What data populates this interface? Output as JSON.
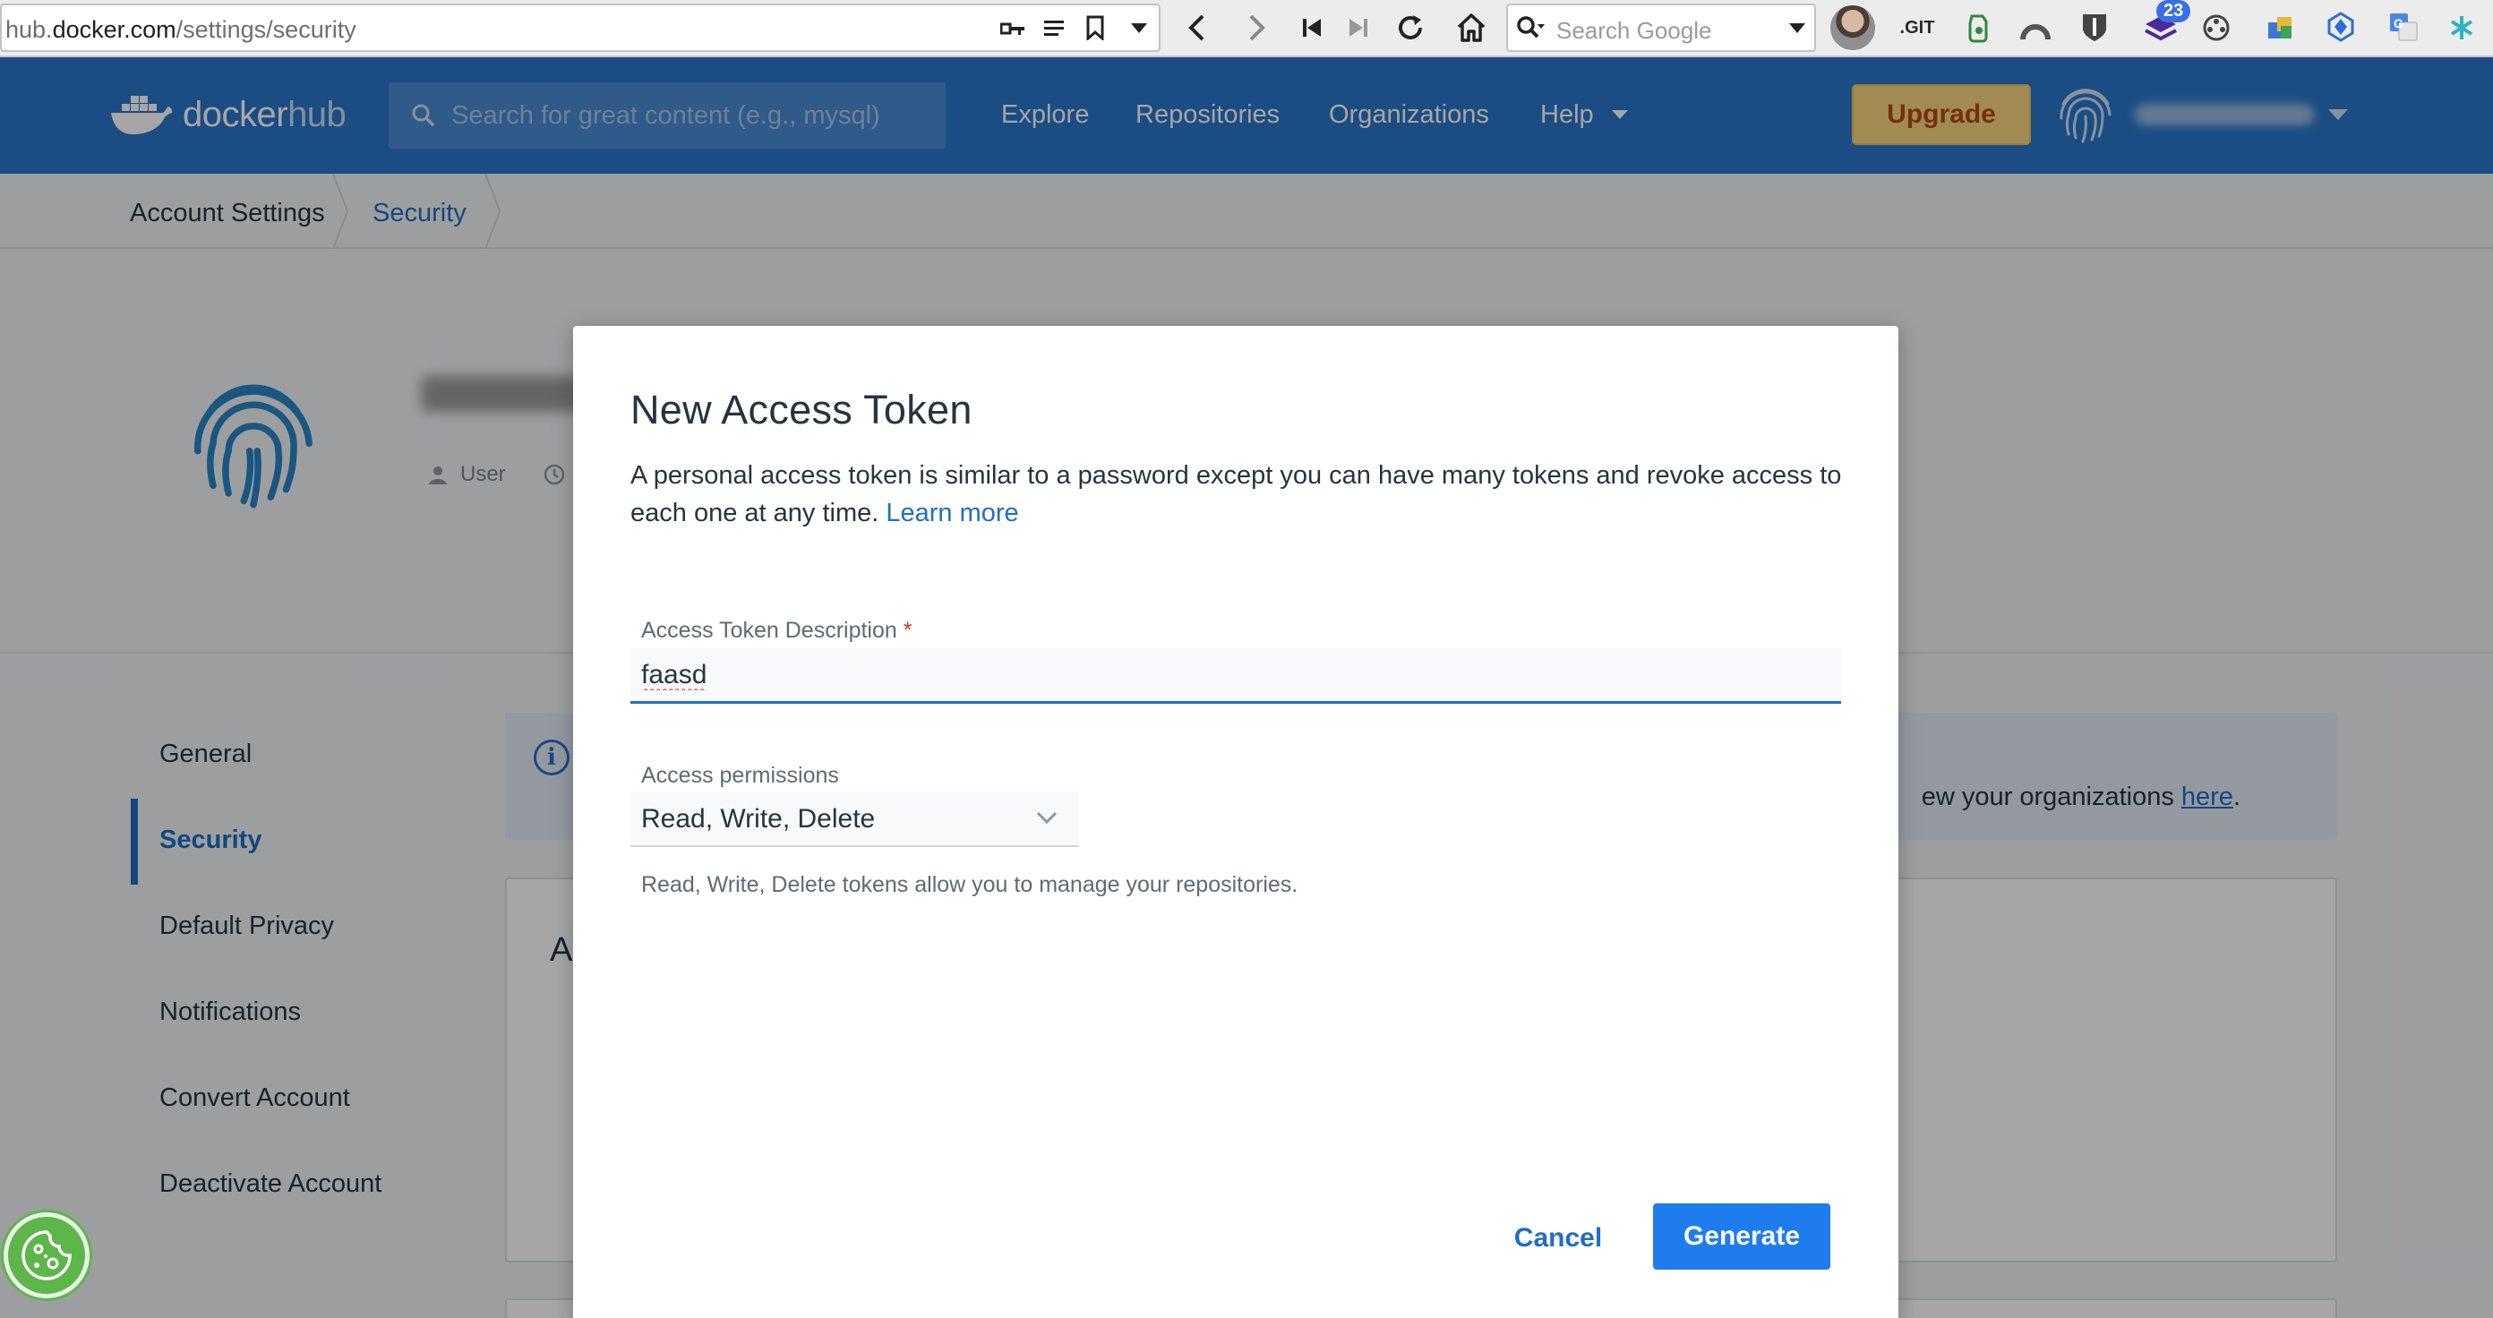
{
  "browser": {
    "url_prefix": "hub.",
    "url_domain": "docker.com",
    "url_path": "/settings/security",
    "search_placeholder": "Search Google",
    "git_label": ".GIT",
    "extension_badge": "23"
  },
  "header": {
    "logo_docker": "docker",
    "logo_hub": "hub",
    "search_placeholder": "Search for great content (e.g., mysql)",
    "nav": {
      "explore": "Explore",
      "repositories": "Repositories",
      "organizations": "Organizations",
      "help": "Help"
    },
    "upgrade_label": "Upgrade"
  },
  "breadcrumb": {
    "items": [
      "Account Settings",
      "Security"
    ]
  },
  "profile": {
    "role": "User"
  },
  "sidebar": {
    "items": [
      {
        "label": "General"
      },
      {
        "label": "Security"
      },
      {
        "label": "Default Privacy"
      },
      {
        "label": "Notifications"
      },
      {
        "label": "Convert Account"
      },
      {
        "label": "Deactivate Account"
      }
    ],
    "active": "Security"
  },
  "main": {
    "info_text_prefix": "ew your organizations ",
    "info_link": "here",
    "info_suffix": ".",
    "card_title_partial": "A"
  },
  "modal": {
    "title": "New Access Token",
    "description": "A personal access token is similar to a password except you can have many tokens and revoke access to each one at any time.",
    "learn_more": "Learn more",
    "description_label": "Access Token Description",
    "required_mark": "*",
    "description_value": "faasd",
    "permissions_label": "Access permissions",
    "permissions_value": "Read, Write, Delete",
    "permissions_help": "Read, Write, Delete tokens allow you to manage your repositories.",
    "cancel_label": "Cancel",
    "generate_label": "Generate"
  },
  "colors": {
    "docker_blue": "#2a76c9",
    "link_blue": "#1f6ec7",
    "primary_button": "#1f7cee",
    "upgrade_bg": "#f7d680",
    "upgrade_text": "#b54a14",
    "required_red": "#d9302c"
  }
}
